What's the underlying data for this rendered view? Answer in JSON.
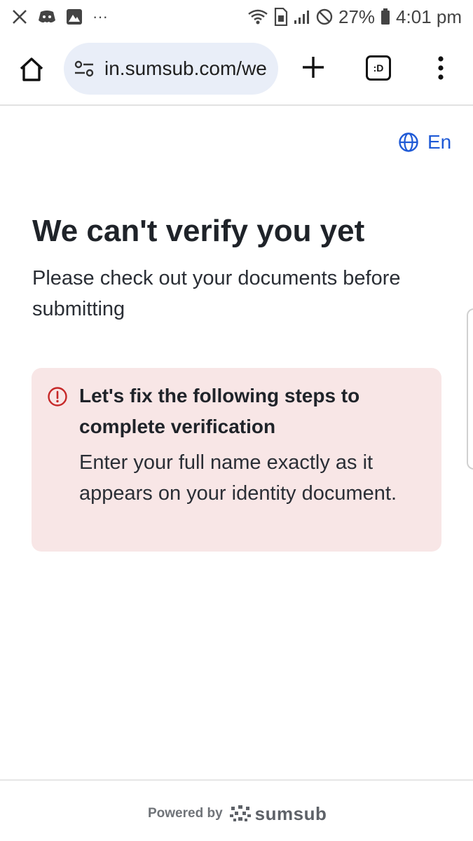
{
  "status_bar": {
    "battery_percent": "27%",
    "time": "4:01 pm",
    "more_notifications": "···"
  },
  "browser": {
    "url": "in.sumsub.com/websdk/p/verify",
    "tabs_label": ":D"
  },
  "page": {
    "language": "En",
    "title": "We can't verify you yet",
    "subtitle": "Please check out your documents before submitting",
    "alert": {
      "heading": "Let's fix the following steps to complete verification",
      "body": "Enter your full name exactly as it appears on your identity document."
    }
  },
  "footer": {
    "powered_by": "Powered by",
    "brand": "sumsub"
  },
  "colors": {
    "accent": "#1f5ad6",
    "alert_bg": "#f8e6e6",
    "alert_icon": "#c62828",
    "url_pill_bg": "#e9eef8"
  }
}
